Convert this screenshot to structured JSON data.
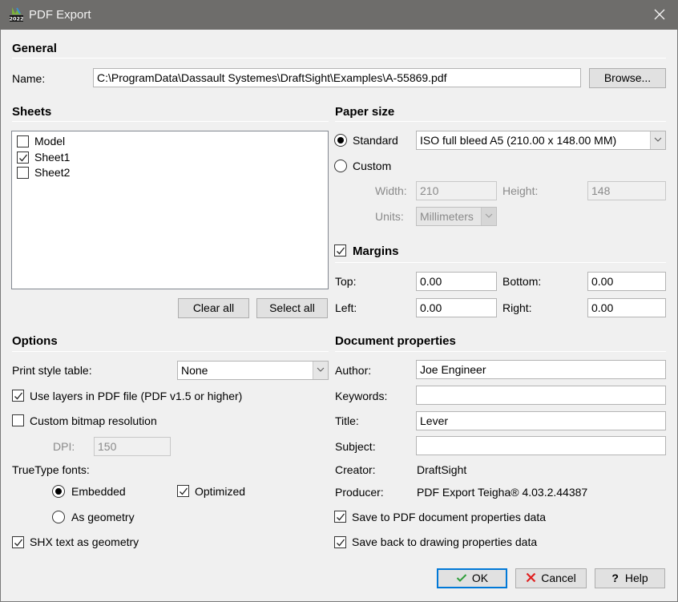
{
  "window": {
    "title": "PDF Export",
    "app_icon": "draftsight-2022-icon",
    "close_icon": "close-icon"
  },
  "general": {
    "heading": "General",
    "name_label": "Name:",
    "name_value": "C:\\ProgramData\\Dassault Systemes\\DraftSight\\Examples\\A-55869.pdf",
    "browse_label": "Browse..."
  },
  "sheets": {
    "heading": "Sheets",
    "items": [
      {
        "label": "Model",
        "checked": false
      },
      {
        "label": "Sheet1",
        "checked": true
      },
      {
        "label": "Sheet2",
        "checked": false
      }
    ],
    "clear_all_label": "Clear all",
    "select_all_label": "Select all"
  },
  "paper_size": {
    "heading": "Paper size",
    "standard_label": "Standard",
    "standard_selected": true,
    "standard_value": "ISO full bleed A5 (210.00 x 148.00 MM)",
    "custom_label": "Custom",
    "custom_selected": false,
    "width_label": "Width:",
    "width_value": "210",
    "height_label": "Height:",
    "height_value": "148",
    "units_label": "Units:",
    "units_value": "Millimeters"
  },
  "margins": {
    "heading": "Margins",
    "enabled": true,
    "top_label": "Top:",
    "top_value": "0.00",
    "bottom_label": "Bottom:",
    "bottom_value": "0.00",
    "left_label": "Left:",
    "left_value": "0.00",
    "right_label": "Right:",
    "right_value": "0.00"
  },
  "options": {
    "heading": "Options",
    "print_style_label": "Print style table:",
    "print_style_value": "None",
    "use_layers_label": "Use layers in PDF file (PDF v1.5 or higher)",
    "use_layers_checked": true,
    "custom_bitmap_label": "Custom bitmap resolution",
    "custom_bitmap_checked": false,
    "dpi_label": "DPI:",
    "dpi_value": "150",
    "truetype_label": "TrueType fonts:",
    "embedded_label": "Embedded",
    "embedded_selected": true,
    "optimized_label": "Optimized",
    "optimized_checked": true,
    "as_geometry_label": "As geometry",
    "as_geometry_selected": false,
    "shx_label": "SHX text as geometry",
    "shx_checked": true
  },
  "doc_props": {
    "heading": "Document properties",
    "author_label": "Author:",
    "author_value": "Joe Engineer",
    "keywords_label": "Keywords:",
    "keywords_value": "",
    "title_label": "Title:",
    "title_value": "Lever",
    "subject_label": "Subject:",
    "subject_value": "",
    "creator_label": "Creator:",
    "creator_value": "DraftSight",
    "producer_label": "Producer:",
    "producer_value": "PDF Export Teigha® 4.03.2.44387",
    "save_pdf_label": "Save to PDF document properties data",
    "save_pdf_checked": true,
    "save_back_label": "Save back to drawing properties data",
    "save_back_checked": true
  },
  "footer": {
    "ok_label": "OK",
    "cancel_label": "Cancel",
    "help_label": "Help",
    "ok_color": "#2e9e3a",
    "cancel_color": "#e02020"
  }
}
